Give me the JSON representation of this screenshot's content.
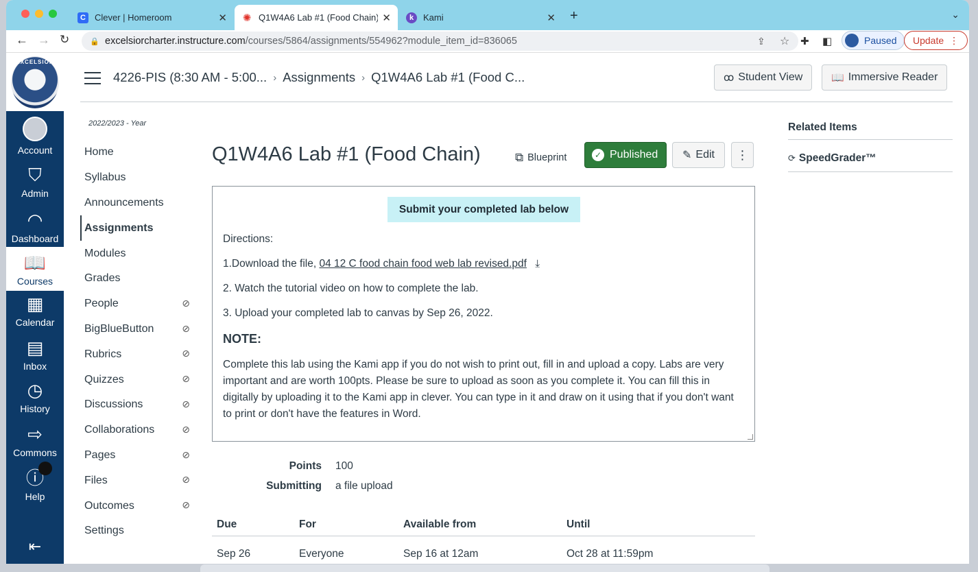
{
  "browser": {
    "tabs": [
      {
        "title": "Clever | Homeroom",
        "favicon": "C",
        "favicon_color": "#2f6cf6"
      },
      {
        "title": "Q1W4A6 Lab #1 (Food Chain)",
        "favicon": "✺",
        "favicon_color": "#e0332b"
      },
      {
        "title": "Kami",
        "favicon": "k",
        "favicon_color": "#6a4bc4"
      }
    ],
    "url_host": "excelsiorcharter.instructure.com",
    "url_path": "/courses/5864/assignments/554962?module_item_id=836065",
    "profile_status": "Paused",
    "update_label": "Update"
  },
  "global_nav": {
    "items": [
      {
        "label": "Account",
        "icon": "account-avatar"
      },
      {
        "label": "Admin",
        "icon": "shield-icon"
      },
      {
        "label": "Dashboard",
        "icon": "dashboard-icon"
      },
      {
        "label": "Courses",
        "icon": "book-icon"
      },
      {
        "label": "Calendar",
        "icon": "calendar-icon"
      },
      {
        "label": "Inbox",
        "icon": "inbox-icon"
      },
      {
        "label": "History",
        "icon": "clock-icon"
      },
      {
        "label": "Commons",
        "icon": "commons-icon"
      },
      {
        "label": "Help",
        "icon": "help-icon"
      }
    ],
    "logo_text": "EXCELSIOR"
  },
  "header": {
    "breadcrumbs": [
      "4226-PIS (8:30 AM - 5:00...",
      "Assignments",
      "Q1W4A6 Lab #1 (Food C..."
    ],
    "student_view": "Student View",
    "immersive_reader": "Immersive Reader"
  },
  "course_nav": {
    "term": "2022/2023 - Year",
    "items": [
      {
        "label": "Home",
        "hidden": false
      },
      {
        "label": "Syllabus",
        "hidden": false
      },
      {
        "label": "Announcements",
        "hidden": false
      },
      {
        "label": "Assignments",
        "hidden": false,
        "active": true
      },
      {
        "label": "Modules",
        "hidden": false
      },
      {
        "label": "Grades",
        "hidden": false
      },
      {
        "label": "People",
        "hidden": true
      },
      {
        "label": "BigBlueButton",
        "hidden": true
      },
      {
        "label": "Rubrics",
        "hidden": true
      },
      {
        "label": "Quizzes",
        "hidden": true
      },
      {
        "label": "Discussions",
        "hidden": true
      },
      {
        "label": "Collaborations",
        "hidden": true
      },
      {
        "label": "Pages",
        "hidden": true
      },
      {
        "label": "Files",
        "hidden": true
      },
      {
        "label": "Outcomes",
        "hidden": true
      },
      {
        "label": "Settings",
        "hidden": false
      }
    ]
  },
  "assignment": {
    "title": "Q1W4A6 Lab #1 (Food Chain)",
    "blueprint": "Blueprint",
    "published": "Published",
    "edit": "Edit",
    "banner": "Submit your completed lab below",
    "directions": "Directions:",
    "step1_prefix": "1.Download the file,",
    "step1_link": "04 12 C food chain food web lab revised.pdf",
    "step2": "2. Watch the tutorial video on how to complete the lab.",
    "step3": "3. Upload your completed lab to canvas by Sep 26, 2022.",
    "note_heading": "NOTE:",
    "note_body": "Complete this lab using the Kami app if you do not wish to print out, fill in and upload a copy.  Labs are very important and are worth 100pts.  Please be sure to upload as soon as you complete it.  You can fill this in digitally by uploading it to the Kami app in clever.  You can type in it and draw on it using that if you don't want to print or don't have the features in Word.",
    "points_label": "Points",
    "points_value": "100",
    "submitting_label": "Submitting",
    "submitting_value": "a file upload",
    "table_headers": [
      "Due",
      "For",
      "Available from",
      "Until"
    ],
    "table_row": [
      "Sep 26",
      "Everyone",
      "Sep 16 at 12am",
      "Oct 28 at 11:59pm"
    ]
  },
  "related": {
    "heading": "Related Items",
    "speedgrader": "SpeedGrader™"
  }
}
